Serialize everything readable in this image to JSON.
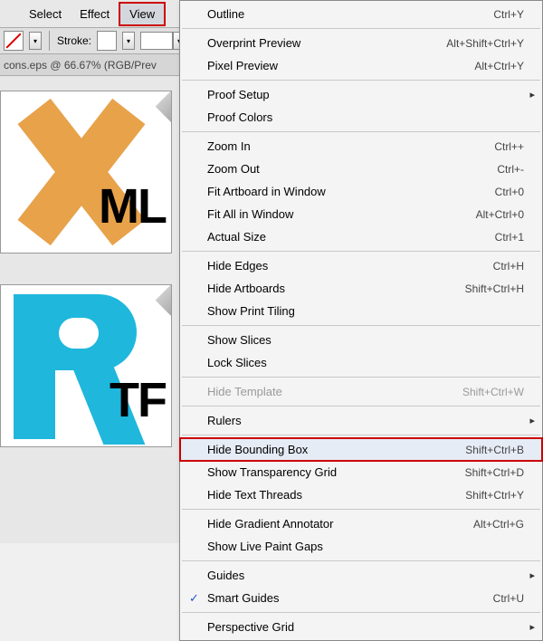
{
  "menubar": {
    "items": [
      "",
      "Select",
      "Effect",
      "View"
    ]
  },
  "toolbar": {
    "stroke_label": "Stroke:",
    "stroke_value": ""
  },
  "tab": {
    "title": "cons.eps @ 66.67% (RGB/Prev"
  },
  "thumbs": {
    "ml": "ML",
    "tf": "TF"
  },
  "menu": {
    "items": [
      {
        "label": "Outline",
        "shortcut": "Ctrl+Y"
      },
      {
        "sep": true
      },
      {
        "label": "Overprint Preview",
        "shortcut": "Alt+Shift+Ctrl+Y"
      },
      {
        "label": "Pixel Preview",
        "shortcut": "Alt+Ctrl+Y"
      },
      {
        "sep": true
      },
      {
        "label": "Proof Setup",
        "submenu": true
      },
      {
        "label": "Proof Colors"
      },
      {
        "sep": true
      },
      {
        "label": "Zoom In",
        "shortcut": "Ctrl++"
      },
      {
        "label": "Zoom Out",
        "shortcut": "Ctrl+-"
      },
      {
        "label": "Fit Artboard in Window",
        "shortcut": "Ctrl+0"
      },
      {
        "label": "Fit All in Window",
        "shortcut": "Alt+Ctrl+0"
      },
      {
        "label": "Actual Size",
        "shortcut": "Ctrl+1"
      },
      {
        "sep": true
      },
      {
        "label": "Hide Edges",
        "shortcut": "Ctrl+H"
      },
      {
        "label": "Hide Artboards",
        "shortcut": "Shift+Ctrl+H"
      },
      {
        "label": "Show Print Tiling"
      },
      {
        "sep": true
      },
      {
        "label": "Show Slices"
      },
      {
        "label": "Lock Slices"
      },
      {
        "sep": true
      },
      {
        "label": "Hide Template",
        "shortcut": "Shift+Ctrl+W",
        "disabled": true
      },
      {
        "sep": true
      },
      {
        "label": "Rulers",
        "submenu": true
      },
      {
        "sep": true
      },
      {
        "label": "Hide Bounding Box",
        "shortcut": "Shift+Ctrl+B",
        "highlight": true
      },
      {
        "label": "Show Transparency Grid",
        "shortcut": "Shift+Ctrl+D"
      },
      {
        "label": "Hide Text Threads",
        "shortcut": "Shift+Ctrl+Y"
      },
      {
        "sep": true
      },
      {
        "label": "Hide Gradient Annotator",
        "shortcut": "Alt+Ctrl+G"
      },
      {
        "label": "Show Live Paint Gaps"
      },
      {
        "sep": true
      },
      {
        "label": "Guides",
        "submenu": true
      },
      {
        "label": "Smart Guides",
        "shortcut": "Ctrl+U",
        "checked": true
      },
      {
        "sep": true
      },
      {
        "label": "Perspective Grid",
        "submenu": true
      }
    ]
  }
}
